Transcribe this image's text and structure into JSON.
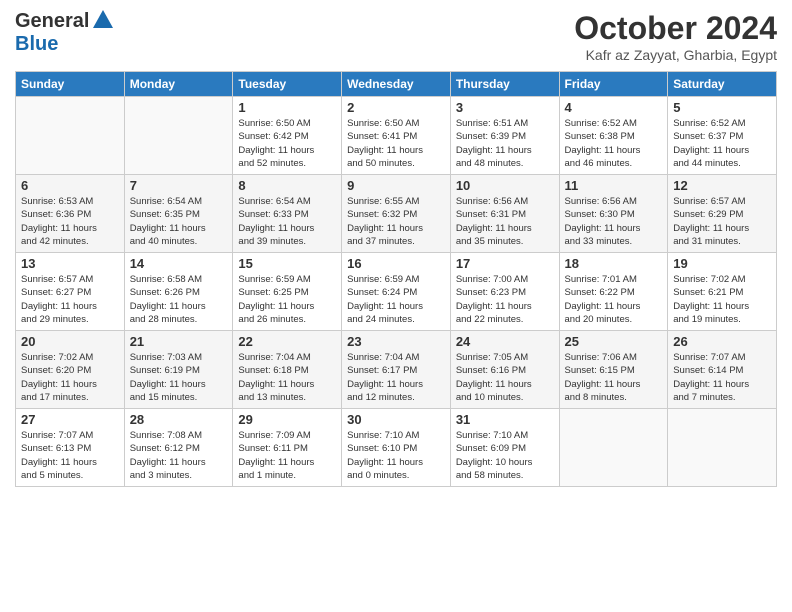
{
  "header": {
    "logo_general": "General",
    "logo_blue": "Blue",
    "title": "October 2024",
    "subtitle": "Kafr az Zayyat, Gharbia, Egypt"
  },
  "days_of_week": [
    "Sunday",
    "Monday",
    "Tuesday",
    "Wednesday",
    "Thursday",
    "Friday",
    "Saturday"
  ],
  "weeks": [
    [
      {
        "day": "",
        "info": ""
      },
      {
        "day": "",
        "info": ""
      },
      {
        "day": "1",
        "info": "Sunrise: 6:50 AM\nSunset: 6:42 PM\nDaylight: 11 hours\nand 52 minutes."
      },
      {
        "day": "2",
        "info": "Sunrise: 6:50 AM\nSunset: 6:41 PM\nDaylight: 11 hours\nand 50 minutes."
      },
      {
        "day": "3",
        "info": "Sunrise: 6:51 AM\nSunset: 6:39 PM\nDaylight: 11 hours\nand 48 minutes."
      },
      {
        "day": "4",
        "info": "Sunrise: 6:52 AM\nSunset: 6:38 PM\nDaylight: 11 hours\nand 46 minutes."
      },
      {
        "day": "5",
        "info": "Sunrise: 6:52 AM\nSunset: 6:37 PM\nDaylight: 11 hours\nand 44 minutes."
      }
    ],
    [
      {
        "day": "6",
        "info": "Sunrise: 6:53 AM\nSunset: 6:36 PM\nDaylight: 11 hours\nand 42 minutes."
      },
      {
        "day": "7",
        "info": "Sunrise: 6:54 AM\nSunset: 6:35 PM\nDaylight: 11 hours\nand 40 minutes."
      },
      {
        "day": "8",
        "info": "Sunrise: 6:54 AM\nSunset: 6:33 PM\nDaylight: 11 hours\nand 39 minutes."
      },
      {
        "day": "9",
        "info": "Sunrise: 6:55 AM\nSunset: 6:32 PM\nDaylight: 11 hours\nand 37 minutes."
      },
      {
        "day": "10",
        "info": "Sunrise: 6:56 AM\nSunset: 6:31 PM\nDaylight: 11 hours\nand 35 minutes."
      },
      {
        "day": "11",
        "info": "Sunrise: 6:56 AM\nSunset: 6:30 PM\nDaylight: 11 hours\nand 33 minutes."
      },
      {
        "day": "12",
        "info": "Sunrise: 6:57 AM\nSunset: 6:29 PM\nDaylight: 11 hours\nand 31 minutes."
      }
    ],
    [
      {
        "day": "13",
        "info": "Sunrise: 6:57 AM\nSunset: 6:27 PM\nDaylight: 11 hours\nand 29 minutes."
      },
      {
        "day": "14",
        "info": "Sunrise: 6:58 AM\nSunset: 6:26 PM\nDaylight: 11 hours\nand 28 minutes."
      },
      {
        "day": "15",
        "info": "Sunrise: 6:59 AM\nSunset: 6:25 PM\nDaylight: 11 hours\nand 26 minutes."
      },
      {
        "day": "16",
        "info": "Sunrise: 6:59 AM\nSunset: 6:24 PM\nDaylight: 11 hours\nand 24 minutes."
      },
      {
        "day": "17",
        "info": "Sunrise: 7:00 AM\nSunset: 6:23 PM\nDaylight: 11 hours\nand 22 minutes."
      },
      {
        "day": "18",
        "info": "Sunrise: 7:01 AM\nSunset: 6:22 PM\nDaylight: 11 hours\nand 20 minutes."
      },
      {
        "day": "19",
        "info": "Sunrise: 7:02 AM\nSunset: 6:21 PM\nDaylight: 11 hours\nand 19 minutes."
      }
    ],
    [
      {
        "day": "20",
        "info": "Sunrise: 7:02 AM\nSunset: 6:20 PM\nDaylight: 11 hours\nand 17 minutes."
      },
      {
        "day": "21",
        "info": "Sunrise: 7:03 AM\nSunset: 6:19 PM\nDaylight: 11 hours\nand 15 minutes."
      },
      {
        "day": "22",
        "info": "Sunrise: 7:04 AM\nSunset: 6:18 PM\nDaylight: 11 hours\nand 13 minutes."
      },
      {
        "day": "23",
        "info": "Sunrise: 7:04 AM\nSunset: 6:17 PM\nDaylight: 11 hours\nand 12 minutes."
      },
      {
        "day": "24",
        "info": "Sunrise: 7:05 AM\nSunset: 6:16 PM\nDaylight: 11 hours\nand 10 minutes."
      },
      {
        "day": "25",
        "info": "Sunrise: 7:06 AM\nSunset: 6:15 PM\nDaylight: 11 hours\nand 8 minutes."
      },
      {
        "day": "26",
        "info": "Sunrise: 7:07 AM\nSunset: 6:14 PM\nDaylight: 11 hours\nand 7 minutes."
      }
    ],
    [
      {
        "day": "27",
        "info": "Sunrise: 7:07 AM\nSunset: 6:13 PM\nDaylight: 11 hours\nand 5 minutes."
      },
      {
        "day": "28",
        "info": "Sunrise: 7:08 AM\nSunset: 6:12 PM\nDaylight: 11 hours\nand 3 minutes."
      },
      {
        "day": "29",
        "info": "Sunrise: 7:09 AM\nSunset: 6:11 PM\nDaylight: 11 hours\nand 1 minute."
      },
      {
        "day": "30",
        "info": "Sunrise: 7:10 AM\nSunset: 6:10 PM\nDaylight: 11 hours\nand 0 minutes."
      },
      {
        "day": "31",
        "info": "Sunrise: 7:10 AM\nSunset: 6:09 PM\nDaylight: 10 hours\nand 58 minutes."
      },
      {
        "day": "",
        "info": ""
      },
      {
        "day": "",
        "info": ""
      }
    ]
  ]
}
